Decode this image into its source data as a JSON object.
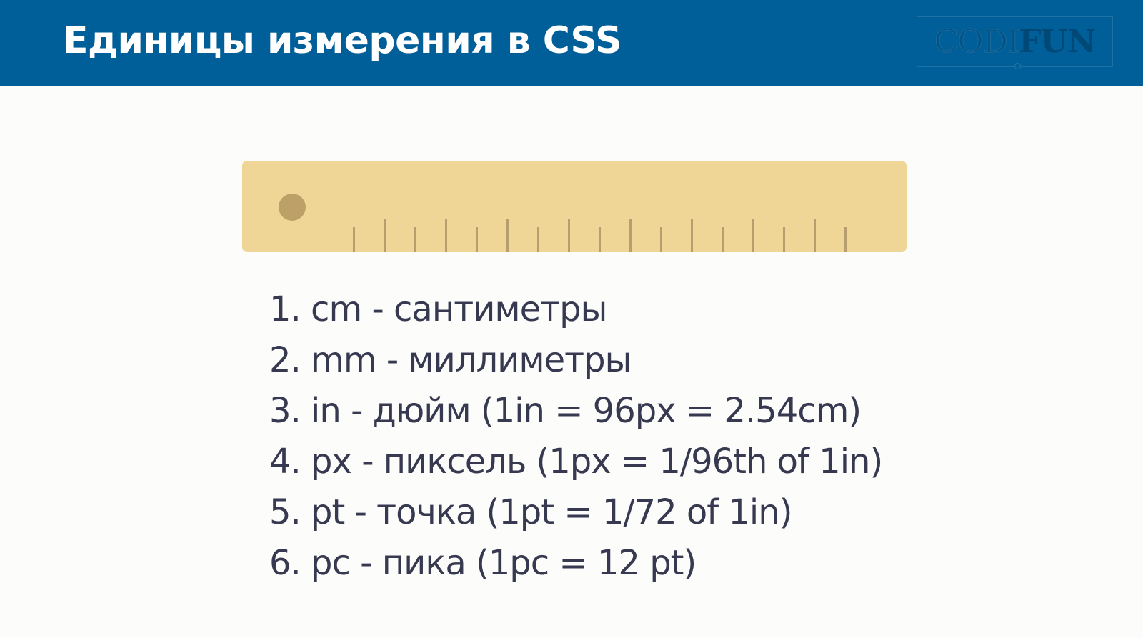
{
  "header": {
    "title": "Единицы измерения в CSS",
    "background": "#005e98",
    "logo": {
      "part_a": "CODI",
      "part_b": "FUN"
    }
  },
  "ruler": {
    "color": "#efd697",
    "hole_color": "#bda068",
    "tick_color": "#b69e6e",
    "tick_count": 17
  },
  "units": [
    "1. cm - сантиметры",
    "2. mm - миллиметры",
    "3. in - дюйм (1in = 96px = 2.54cm)",
    "4. px - пиксель (1px = 1/96th of 1in)",
    "5. pt - точка (1pt = 1/72 of 1in)",
    "6. pc - пика (1pc = 12 pt)"
  ],
  "text_color": "#36394f"
}
